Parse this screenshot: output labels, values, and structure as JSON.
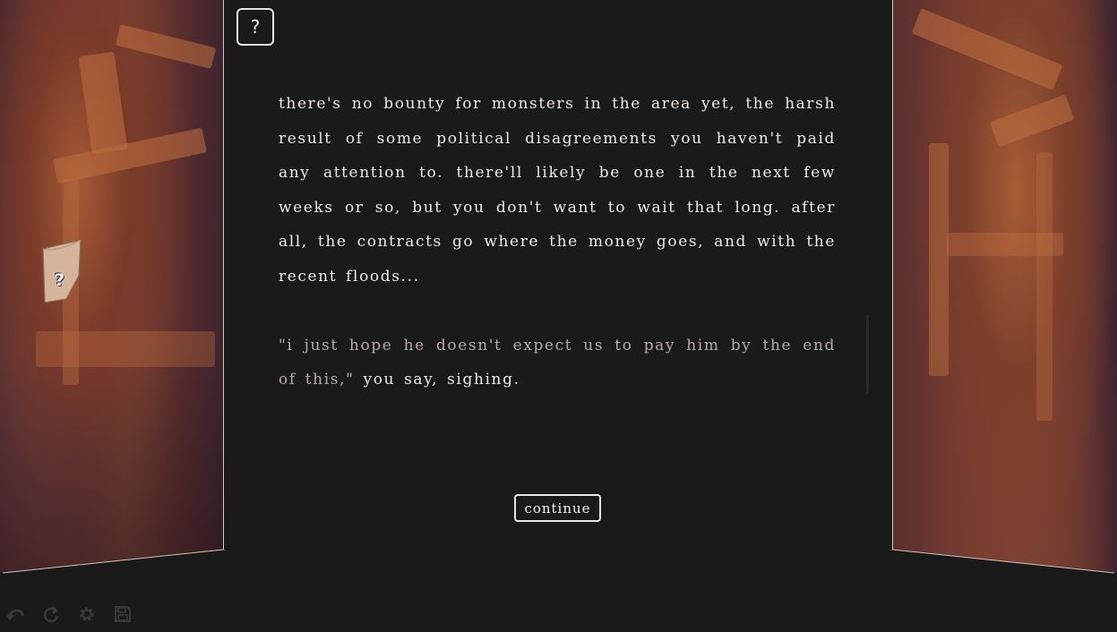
{
  "help_button": {
    "label": "?"
  },
  "note_icon": {
    "label": "?"
  },
  "story": {
    "narration": "there's no bounty for monsters in the area yet, the harsh result of some political disagreements you haven't paid any attention to. there'll likely be one in the next few weeks or so, but you don't want to wait that long. after all, the contracts go where the money goes, and with the recent floods...",
    "dialogue": "\"i just hope he doesn't expect us to pay him by the end of this,\"",
    "dialogue_tag": " you say, sighing."
  },
  "continue_button": {
    "label": "continue"
  },
  "toolbar": {
    "items": [
      "undo-icon",
      "redo-icon",
      "settings-icon",
      "save-icon"
    ]
  },
  "colors": {
    "background": "#1b1a1b",
    "text": "#efe8e3",
    "dialogue": "#b9a6b5",
    "border": "#d8cbb6"
  }
}
